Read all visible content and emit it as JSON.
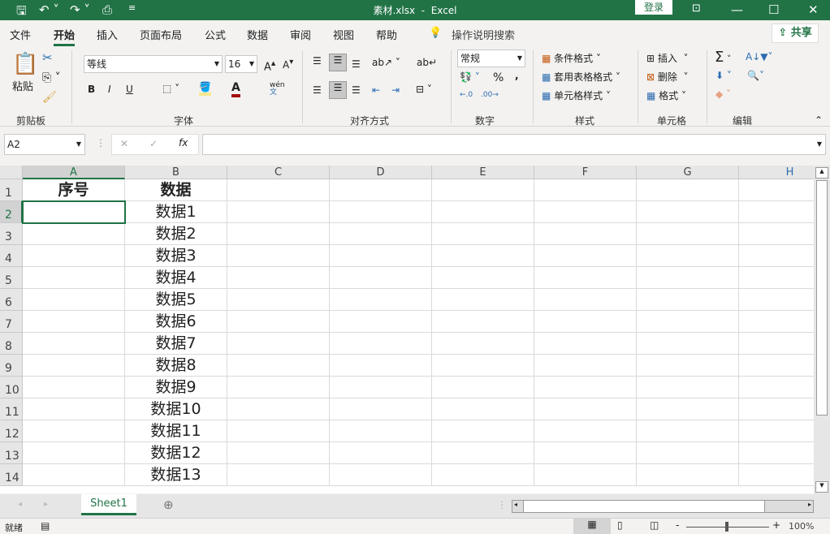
{
  "title_bar": {
    "filename": "素材.xlsx",
    "sep": "-",
    "app": "Excel",
    "login": "登录"
  },
  "quick_access": {
    "save": "save-icon",
    "undo": "undo-icon",
    "redo": "redo-icon",
    "preview": "print-preview-icon"
  },
  "tabs": [
    {
      "label": "文件"
    },
    {
      "label": "开始",
      "active": true
    },
    {
      "label": "插入"
    },
    {
      "label": "页面布局"
    },
    {
      "label": "公式"
    },
    {
      "label": "数据"
    },
    {
      "label": "审阅"
    },
    {
      "label": "视图"
    },
    {
      "label": "帮助"
    }
  ],
  "tell_me": "操作说明搜索",
  "share": "共享",
  "ribbon": {
    "clipboard": {
      "paste": "粘贴",
      "group": "剪贴板"
    },
    "font": {
      "name": "等线",
      "size": "16",
      "bold": "B",
      "italic": "I",
      "underline": "U",
      "phonetic": "wén",
      "group": "字体"
    },
    "alignment": {
      "group": "对齐方式"
    },
    "number": {
      "format": "常规",
      "percent": "%",
      "comma": ",",
      "group": "数字"
    },
    "styles": {
      "conditional": "条件格式",
      "table": "套用表格格式",
      "cell": "单元格样式",
      "group": "样式"
    },
    "cells": {
      "insert": "插入",
      "delete": "删除",
      "format": "格式",
      "group": "单元格"
    },
    "editing": {
      "sum": "Σ",
      "group": "编辑"
    }
  },
  "formula_bar": {
    "name_box": "A2",
    "fx": "fx",
    "value": ""
  },
  "columns": [
    "A",
    "B",
    "C",
    "D",
    "E",
    "F",
    "G",
    "H"
  ],
  "rows": [
    {
      "n": "1",
      "a": "序号",
      "b": "数据"
    },
    {
      "n": "2",
      "a": "",
      "b": "数据1"
    },
    {
      "n": "3",
      "a": "",
      "b": "数据2"
    },
    {
      "n": "4",
      "a": "",
      "b": "数据3"
    },
    {
      "n": "5",
      "a": "",
      "b": "数据4"
    },
    {
      "n": "6",
      "a": "",
      "b": "数据5"
    },
    {
      "n": "7",
      "a": "",
      "b": "数据6"
    },
    {
      "n": "8",
      "a": "",
      "b": "数据7"
    },
    {
      "n": "9",
      "a": "",
      "b": "数据8"
    },
    {
      "n": "10",
      "a": "",
      "b": "数据9"
    },
    {
      "n": "11",
      "a": "",
      "b": "数据10"
    },
    {
      "n": "12",
      "a": "",
      "b": "数据11"
    },
    {
      "n": "13",
      "a": "",
      "b": "数据12"
    },
    {
      "n": "14",
      "a": "",
      "b": "数据13"
    }
  ],
  "sheet_tabs": [
    {
      "label": "Sheet1",
      "active": true
    }
  ],
  "status": {
    "ready": "就绪",
    "zoom": "100%",
    "minus": "-",
    "plus": "+"
  },
  "colors": {
    "accent": "#217346"
  }
}
